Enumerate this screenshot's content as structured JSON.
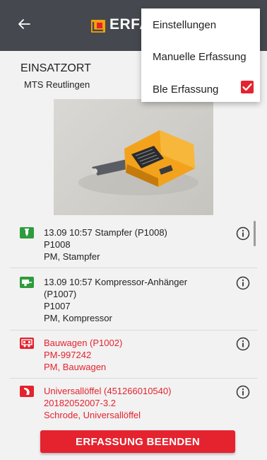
{
  "app_bar": {
    "title": "ERFA",
    "back_icon": "arrow-left-icon",
    "logo_icon": "app-logo-icon",
    "background": "#45494f"
  },
  "menu": {
    "items": [
      {
        "label": "Einstellungen"
      },
      {
        "label": "Manuelle Erfassung"
      },
      {
        "label": "Ble Erfassung",
        "checked": true
      }
    ]
  },
  "site": {
    "title": "EINSATZORT",
    "location": "MTS Reutlingen"
  },
  "list": [
    {
      "icon": "tamper-machine-icon",
      "icon_color": "#2e9b3e",
      "status": "ok",
      "line1": "13.09 10:57  Stampfer (P1008)",
      "line2": "P1008",
      "line3": "PM,  Stampfer"
    },
    {
      "icon": "compressor-trailer-icon",
      "icon_color": "#2e9b3e",
      "status": "ok",
      "line1": "13.09 10:57  Kompressor-Anhänger\n(P1007)",
      "line2": "P1007",
      "line3": "PM,  Kompressor"
    },
    {
      "icon": "construction-trailer-icon",
      "icon_color": "#e4232f",
      "status": "missing",
      "line1": "Bauwagen (P1002)",
      "line2": "PM-997242",
      "line3": "PM,  Bauwagen"
    },
    {
      "icon": "excavator-bucket-icon",
      "icon_color": "#e4232f",
      "status": "missing",
      "line1": "Universallöffel (451266010540)",
      "line2": "20182052007-3.2",
      "line3": "Schrode,  Universallöffel"
    }
  ],
  "actions": {
    "end_label": "ERFASSUNG BEENDEN"
  },
  "colors": {
    "accent": "#e4232f",
    "ok": "#2e9b3e",
    "background": "#f2f2f2"
  }
}
